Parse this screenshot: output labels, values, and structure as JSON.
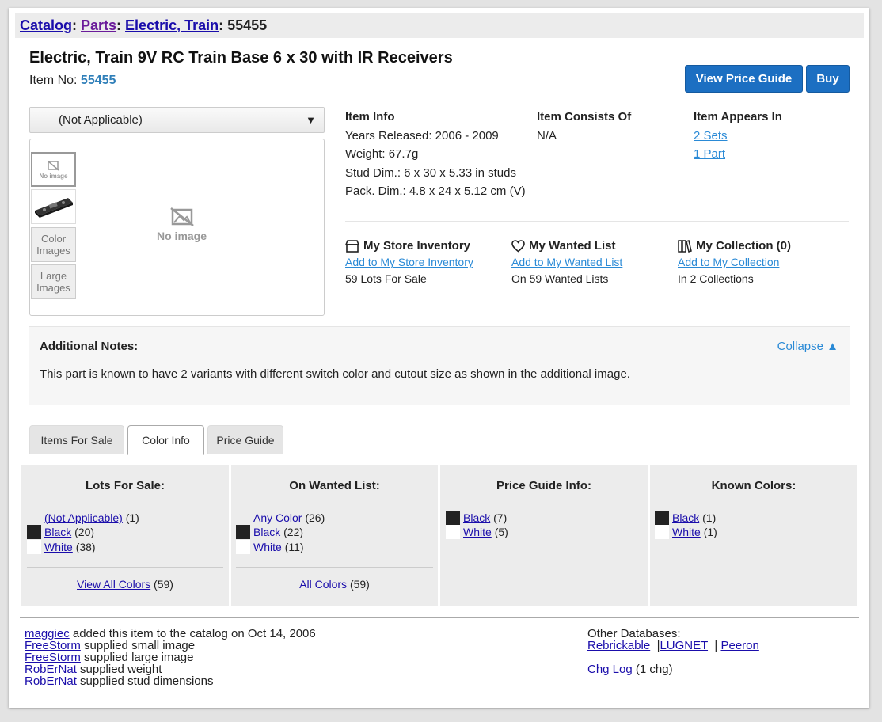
{
  "breadcrumb": {
    "catalog": "Catalog",
    "parts": "Parts",
    "category": "Electric, Train",
    "item": "55455"
  },
  "item": {
    "title": "Electric, Train 9V RC Train Base 6 x 30 with IR Receivers",
    "no_label": "Item No:",
    "no_value": "55455"
  },
  "buttons": {
    "price_guide": "View Price Guide",
    "buy": "Buy"
  },
  "color_select": {
    "value": "(Not Applicable)",
    "arrow": "▼"
  },
  "thumbs": {
    "noimage_small": "No image",
    "color_images": "Color Images",
    "large_images": "Large Images",
    "noimage_large": "No image"
  },
  "item_info": {
    "heading": "Item Info",
    "years": "Years Released: 2006 - 2009",
    "weight": "Weight: 67.7g",
    "stud": "Stud Dim.: 6 x 30 x 5.33 in studs",
    "pack": "Pack. Dim.: 4.8 x 24 x 5.12 cm (V)"
  },
  "consists": {
    "heading": "Item Consists Of",
    "value": "N/A"
  },
  "appears": {
    "heading": "Item Appears In",
    "sets": "2 Sets",
    "parts": "1 Part"
  },
  "store": {
    "heading": "My Store Inventory",
    "link": "Add to My Store Inventory",
    "stat": "59 Lots For Sale"
  },
  "wanted": {
    "heading": "My Wanted List",
    "link": "Add to My Wanted List",
    "stat": "On 59 Wanted Lists"
  },
  "collection": {
    "heading": "My Collection (0)",
    "link": "Add to My Collection",
    "stat": "In 2 Collections"
  },
  "notes": {
    "heading": "Additional Notes:",
    "collapse": "Collapse ▲",
    "text": "This part is known to have 2 variants with different switch color and cutout size as shown in the additional image."
  },
  "tabs": {
    "for_sale": "Items For Sale",
    "color_info": "Color Info",
    "price_guide": "Price Guide"
  },
  "panels": {
    "lots": {
      "heading": "Lots For Sale:",
      "rows": [
        {
          "name": "(Not Applicable)",
          "count": "(1)"
        },
        {
          "name": "Black",
          "count": "(20)"
        },
        {
          "name": "White",
          "count": "(38)"
        }
      ],
      "footer_link": "View All Colors",
      "footer_count": "(59)"
    },
    "wanted": {
      "heading": "On Wanted List:",
      "rows": [
        {
          "name": "Any Color",
          "count": "(26)"
        },
        {
          "name": "Black",
          "count": "(22)"
        },
        {
          "name": "White",
          "count": "(11)"
        }
      ],
      "footer_link": "All Colors",
      "footer_count": "(59)"
    },
    "price": {
      "heading": "Price Guide Info:",
      "rows": [
        {
          "name": "Black",
          "count": "(7)"
        },
        {
          "name": "White",
          "count": "(5)"
        }
      ]
    },
    "known": {
      "heading": "Known Colors:",
      "rows": [
        {
          "name": "Black",
          "count": "(1)"
        },
        {
          "name": "White",
          "count": "(1)"
        }
      ]
    }
  },
  "credits": [
    {
      "user": "maggiec",
      "text": " added this item to the catalog on Oct 14, 2006"
    },
    {
      "user": "FreeStorm",
      "text": " supplied small image"
    },
    {
      "user": "FreeStorm",
      "text": " supplied large image"
    },
    {
      "user": "RobErNat",
      "text": " supplied weight"
    },
    {
      "user": "RobErNat",
      "text": " supplied stud dimensions"
    }
  ],
  "other_db": {
    "label": "Other Databases:",
    "rebrickable": "Rebrickable",
    "lugnet": "LUGNET",
    "peeron": "Peeron",
    "sep": "|",
    "chglog": "Chg Log",
    "chglog_count": "(1 chg)"
  },
  "colors": {
    "accent_button": "#1c6fc2",
    "link_blue": "#2a8ad6",
    "black_swatch": "#222222",
    "white_swatch": "#ffffff"
  }
}
